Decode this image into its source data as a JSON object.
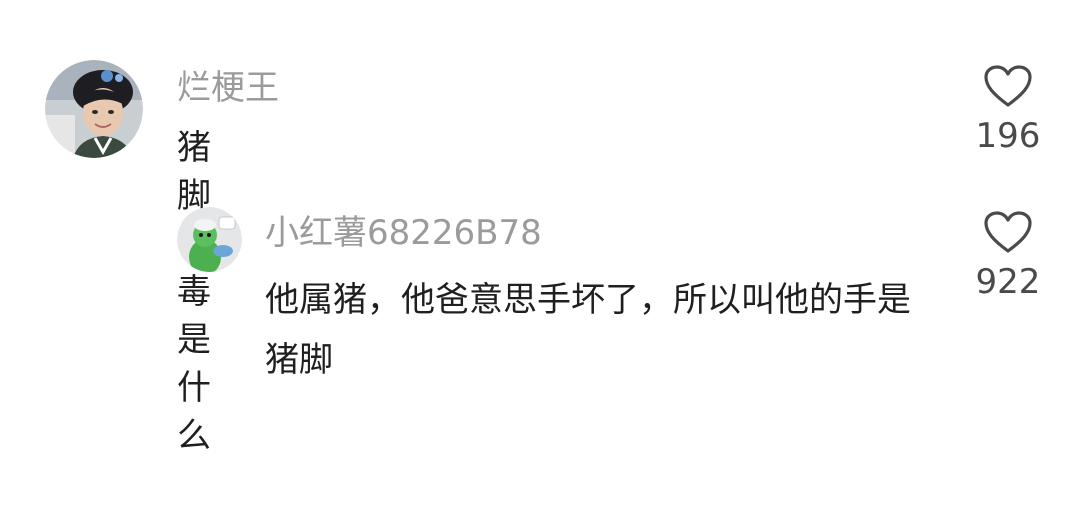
{
  "comments": [
    {
      "username": "烂梗王",
      "text": "猪脚中毒是什么",
      "likes": "196",
      "avatar": "person-photo-avatar"
    },
    {
      "username": "小红薯68226B78",
      "text": "他属猪，他爸意思手坏了，所以叫他的手是猪脚",
      "likes": "922",
      "avatar": "green-cartoon-avatar",
      "avatar_badge": "猫！"
    }
  ],
  "colors": {
    "username": "#9b9b9b",
    "text": "#1f1f1f",
    "count": "#4a4a4a",
    "heart_outline": "#4a4a4a"
  }
}
